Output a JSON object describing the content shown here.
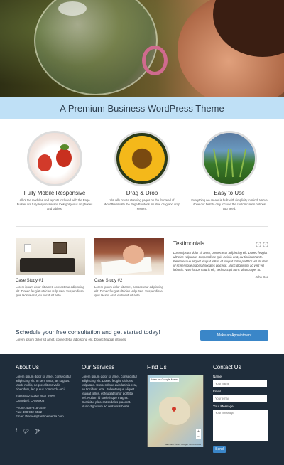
{
  "hero": {},
  "tagline": "A Premium Business WordPress Theme",
  "features": [
    {
      "title": "Fully Mobile Responsive",
      "desc": "All of the modules and layouts included with the Page Builder are fully responsive and look gorgeous on phones and tablets."
    },
    {
      "title": "Drag & Drop",
      "desc": "Visually create stunning pages on the frontend of WordPress with the Page Builder's intuitive drag and drop system."
    },
    {
      "title": "Easy to Use",
      "desc": "Everything we create is built with simplicity in mind. We've done our best to only include the customization options you need."
    }
  ],
  "cases": [
    {
      "title": "Case Study #1",
      "text": "Lorem ipsum dolor sit amet, consectetur adipiscing elit. Donec feugiat ultricies vulputate. Suspendisse quis lacinia erat, eu tincidunt ante."
    },
    {
      "title": "Case Study #2",
      "text": "Lorem ipsum dolor sit amet, consectetur adipiscing elit. Donec feugiat ultricies vulputate. Suspendisse quis lacinia erat, eu tincidunt ante."
    }
  ],
  "testimonials": {
    "title": "Testimonials",
    "quote": "Lorem ipsum dolor sit amet, consectetur adipiscing elit. Donec feugiat ultricies vulputate. Suspendisse quis lacinia erat, eu tincidunt ante. Pellentesque aliquet feugiat tellus, et feugiat tortor porttitor vel. Nullam id scelerisque placerat sodales placerat. Nunc dignissim ac velit vel lobortis. Nam luctus mauris elit, sed suscipit nunc ullamcorper ut.",
    "author": "- John Doe"
  },
  "cta": {
    "title": "Schedule your free consultation and get started today!",
    "subtitle": "Lorem ipsum dolor sit amet, consectetur adipiscing elit. Donec feugiat ultricies.",
    "button": "Make an Appointment"
  },
  "footer": {
    "about": {
      "heading": "About Us",
      "text": "Lorem ipsum dolor sit amet, consectetur adipiscing elit. In sem tortor, ac sagittis. Morbi mollis, neque elit convallis bibendum, leo purus commodo orci.",
      "address1": "1565 Winchester Blvd. #202",
      "address2": "Campbell, CA 95008",
      "phone": "Phone: 408-915-7520",
      "fax": "Fax: 408-932-4522",
      "email": "Email: themes@fastlinemedia.com"
    },
    "services": {
      "heading": "Our Services",
      "text": "Lorem ipsum dolor sit amet, consectetur adipiscing elit. Donec feugiat ultricies vulputate. Suspendisse quis lacinia erat, eu tincidunt ante. Pellentesque aliquet feugiat tellus, et feugiat tortor porttitor vel. Nullam id scelerisque magna. Curabitur placerat sodales placerat. Nunc dignissim ac velit vel lobortis."
    },
    "find": {
      "heading": "Find Us",
      "map_link": "View on Google Maps",
      "map_credit": "Map data ©2014 Google  Terms of Use"
    },
    "contact": {
      "heading": "Contact Us",
      "name_label": "Name",
      "name_placeholder": "Your name",
      "email_label": "Email",
      "email_placeholder": "Your email",
      "message_label": "Your Message",
      "message_placeholder": "Your message",
      "send": "Send"
    },
    "social_icons": [
      "facebook-icon",
      "twitter-icon",
      "google-plus-icon"
    ]
  },
  "colors": {
    "band": "#bfe0f6",
    "accent": "#3a86c8",
    "footer_bg": "#1f2d3b"
  }
}
